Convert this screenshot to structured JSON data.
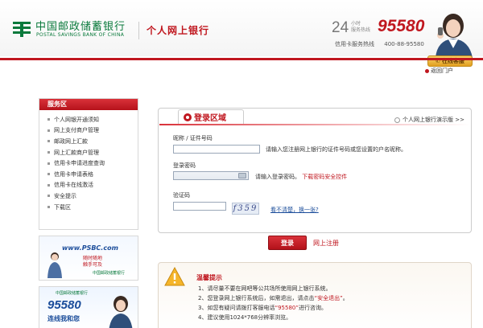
{
  "header": {
    "logo_cn": "中国邮政储蓄银行",
    "logo_en": "POSTAL SAVINGS BANK OF CHINA",
    "title": "个人网上银行",
    "hotline_24": "24",
    "hotline_small_1": "小时",
    "hotline_small_2": "服务热线",
    "hotline_number": "95580",
    "card_hotline_label": "信用卡服务热线",
    "card_hotline_number": "400-88-95580",
    "online_service": "在线客服",
    "portal_link": "返回门户"
  },
  "sidebar": {
    "title": "服务区",
    "items": [
      {
        "label": "个人网银开通须知"
      },
      {
        "label": "网上支付商户管理"
      },
      {
        "label": "邮政网上汇款"
      },
      {
        "label": "网上汇款商户管理"
      },
      {
        "label": "信用卡申请进度查询"
      },
      {
        "label": "信用卡申请表格"
      },
      {
        "label": "信用卡在线激活"
      },
      {
        "label": "安全提示"
      },
      {
        "label": "下载区"
      }
    ]
  },
  "ads": {
    "ad1_site": "www.PSBC.com",
    "ad1_slogan_1": "随时随地",
    "ad1_slogan_2": "触手可及",
    "ad1_bank": "中国邮政储蓄银行",
    "ad2_bank": "中国邮政储蓄银行",
    "ad2_number": "95580",
    "ad2_slogan": "连线我和您"
  },
  "login": {
    "tab_title": "登录区域",
    "demo_link": "个人网上银行演示版 >>",
    "account_label": "昵称 / 证件号码",
    "account_value": "",
    "account_hint": "请输入您注册网上银行的证件号码或您设置的户名昵称。",
    "password_label": "登录密码",
    "password_hint": "请输入登录密码。",
    "password_hint_link": "下载密码安全控件",
    "captcha_label": "验证码",
    "captcha_value": "",
    "captcha_image_text": "f359",
    "captcha_refresh": "看不清楚，换一张?",
    "login_button": "登录",
    "register_link": "网上注册"
  },
  "tips": {
    "title": "温馨提示",
    "lines": [
      {
        "pre": "1、请尽量不要在网吧等公共场所使用网上银行系统。",
        "red": "",
        "post": ""
      },
      {
        "pre": "2、您登录网上银行系统后，如需退出，请点击",
        "red": "“安全退出”",
        "post": "。"
      },
      {
        "pre": "3、如您有疑问请拨打客服电话",
        "red": "“95580”",
        "post": "进行咨询。"
      },
      {
        "pre": "4、建议使用1024*768分辨率浏览。",
        "red": "",
        "post": ""
      }
    ]
  },
  "colors": {
    "brand_red": "#c0171f",
    "brand_green": "#0a7a3c",
    "link_blue": "#1a4c9a"
  }
}
